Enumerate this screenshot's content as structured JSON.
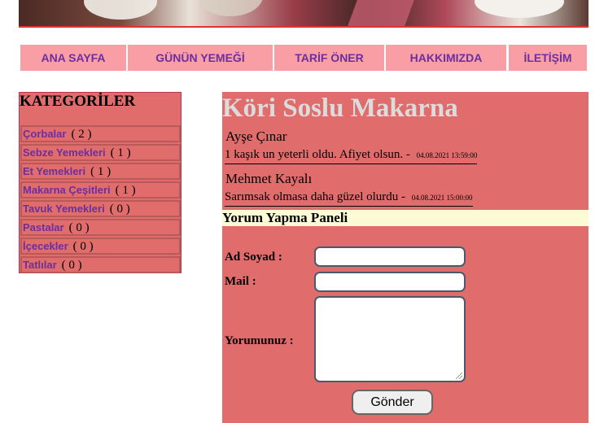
{
  "nav": {
    "items": [
      "ANA SAYFA",
      "GÜNÜN YEMEĞİ",
      "TARİF ÖNER",
      "HAKKIMIZDA",
      "İLETİŞİM"
    ]
  },
  "categories": {
    "title": "KATEGORİLER",
    "items": [
      {
        "label": "Çorbalar",
        "count": "( 2 )"
      },
      {
        "label": "Sebze Yemekleri",
        "count": "( 1 )"
      },
      {
        "label": "Et Yemekleri",
        "count": "( 1 )"
      },
      {
        "label": "Makarna Çeşitleri",
        "count": "( 1 )"
      },
      {
        "label": "Tavuk Yemekleri",
        "count": "( 0 )"
      },
      {
        "label": "Pastalar",
        "count": "( 0 )"
      },
      {
        "label": "İçecekler",
        "count": "( 0 )"
      },
      {
        "label": "Tatlılar",
        "count": "( 0 )"
      }
    ]
  },
  "recipe": {
    "title": "Köri Soslu Makarna"
  },
  "comments": [
    {
      "author": "Ayşe Çınar",
      "text": "1 kaşık un yeterli oldu. Afiyet olsun.",
      "sep": "-",
      "date": "04.08.2021 13:59:00"
    },
    {
      "author": "Mehmet Kayalı",
      "text": "Sarımsak olmasa daha güzel olurdu",
      "sep": "-",
      "date": "04.08.2021 15:00:00"
    }
  ],
  "form": {
    "title": "Yorum Yapma Paneli",
    "name_label": "Ad Soyad :",
    "mail_label": "Mail :",
    "comment_label": "Yorumunuz :",
    "submit_label": "Gönder",
    "name_value": "",
    "mail_value": "",
    "comment_value": ""
  },
  "colors": {
    "nav_bg": "#f99ea5",
    "link": "#6b2fa0",
    "panel_bg": "#e06c6c",
    "form_header_bg": "#fdfbd6",
    "title_text": "#dcdcdc"
  }
}
